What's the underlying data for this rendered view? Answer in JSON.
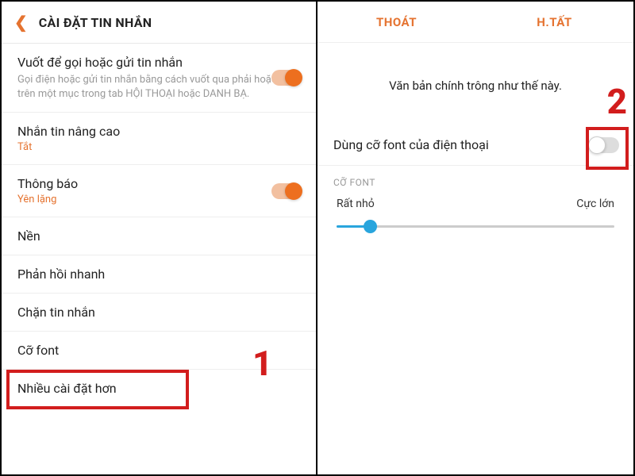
{
  "left": {
    "title": "CÀI ĐẶT TIN NHẮN",
    "swipe": {
      "title": "Vuốt để gọi hoặc gửi tin nhắn",
      "desc": "Gọi điện hoặc gửi tin nhắn bằng cách vuốt qua phải hoặc trái trên một mục trong tab HỘI THOẠI hoặc DANH BẠ."
    },
    "advanced": {
      "title": "Nhắn tin nâng cao",
      "state": "Tắt"
    },
    "notify": {
      "title": "Thông báo",
      "state": "Yên lặng"
    },
    "background": "Nền",
    "quickreply": "Phản hồi nhanh",
    "block": "Chặn tin nhắn",
    "fontsize": "Cỡ font",
    "more": "Nhiều cài đặt hơn",
    "annot": "1"
  },
  "right": {
    "exit": "THOÁT",
    "done": "H.TẤT",
    "preview": "Văn bản chính trông như thế này.",
    "usePhoneFont": "Dùng cỡ font của điện thoại",
    "sectionLabel": "CỠ FONT",
    "small": "Rất nhỏ",
    "large": "Cực lớn",
    "annot": "2"
  }
}
